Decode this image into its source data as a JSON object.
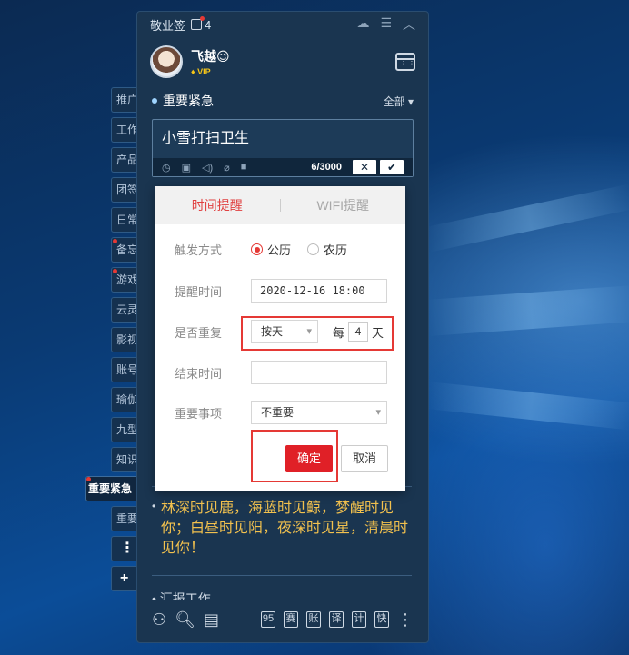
{
  "app": {
    "title": "敬业签",
    "notification_count": "4",
    "titlebar_icons": [
      "cloud-icon",
      "menu-icon",
      "collapse-icon"
    ]
  },
  "user": {
    "name": "飞越😉",
    "badge": "VIP"
  },
  "side_tabs": [
    {
      "label": "推广",
      "dot": false
    },
    {
      "label": "工作",
      "dot": false
    },
    {
      "label": "产品",
      "dot": false
    },
    {
      "label": "团签",
      "dot": false
    },
    {
      "label": "日常",
      "dot": false
    },
    {
      "label": "备忘",
      "dot": true
    },
    {
      "label": "游戏",
      "dot": true
    },
    {
      "label": "云灵",
      "dot": false
    },
    {
      "label": "影视",
      "dot": false
    },
    {
      "label": "账号",
      "dot": false
    },
    {
      "label": "瑜伽",
      "dot": false
    },
    {
      "label": "九型",
      "dot": false
    },
    {
      "label": "知识",
      "dot": false
    },
    {
      "label": "重要紧急",
      "dot": true,
      "highlighted": true
    },
    {
      "label": "重要",
      "dot": false
    },
    {
      "label": "⋮",
      "dot": false
    },
    {
      "label": "+",
      "dot": false
    }
  ],
  "section": {
    "title": "重要紧急",
    "filter_label": "全部"
  },
  "editor": {
    "text": "小雪打扫卫生",
    "char_count": "6/3000",
    "cancel_symbol": "✕",
    "confirm_symbol": "✔"
  },
  "reminder_dialog": {
    "tabs": [
      "时间提醒",
      "WIFI提醒"
    ],
    "active_tab": 0,
    "trigger": {
      "label": "触发方式",
      "options": [
        "公历",
        "农历"
      ],
      "selected": "公历"
    },
    "remind_time": {
      "label": "提醒时间",
      "value": "2020-12-16 18:00"
    },
    "repeat": {
      "label": "是否重复",
      "mode": "按天",
      "every_label": "每",
      "interval": "4",
      "unit": "天"
    },
    "end_time": {
      "label": "结束时间",
      "value": ""
    },
    "importance": {
      "label": "重要事项",
      "value": "不重要"
    },
    "confirm_label": "确定",
    "cancel_label": "取消"
  },
  "notes": [
    {
      "text": "林深时见鹿，海蓝时见鲸，梦醒时见你；白昼时见阳，夜深时见星，清晨时见你！",
      "color": "#f2c14e"
    },
    {
      "text": "汇报工作",
      "color": "#cfd9e4"
    }
  ],
  "bottom_toolbar": {
    "left_icons": [
      "users-icon",
      "search-icon",
      "notes-icon"
    ],
    "quick_buttons": [
      "95",
      "赛",
      "账",
      "译",
      "计",
      "快"
    ]
  }
}
